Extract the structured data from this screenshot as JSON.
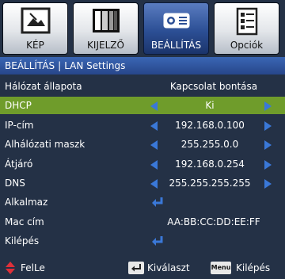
{
  "tabs": [
    {
      "label": "KÉP",
      "icon": "picture-icon",
      "active": false
    },
    {
      "label": "KIJELZŐ",
      "icon": "display-icon",
      "active": false
    },
    {
      "label": "BEÁLLÍTÁS",
      "icon": "projector-icon",
      "active": true
    },
    {
      "label": "Opciók",
      "icon": "options-icon",
      "active": false
    }
  ],
  "header": {
    "section": "BEÁLLÍTÁS",
    "separator": "|",
    "page": "LAN Settings"
  },
  "rows": {
    "status": {
      "label": "Hálózat állapota",
      "value": "Kapcsolat bontása"
    },
    "dhcp": {
      "label": "DHCP",
      "value": "Ki"
    },
    "ip": {
      "label": "IP-cím",
      "value": "192.168.0.100"
    },
    "subnet": {
      "label": "Alhálózati maszk",
      "value": "255.255.0.0"
    },
    "gateway": {
      "label": "Átjáró",
      "value": "192.168.0.254"
    },
    "dns": {
      "label": "DNS",
      "value": "255.255.255.255"
    },
    "apply": {
      "label": "Alkalmaz"
    },
    "mac": {
      "label": "Mac cím",
      "value": "AA:BB:CC:DD:EE:FF"
    },
    "exit": {
      "label": "Kilépés"
    }
  },
  "footer": {
    "nav_label": "FelLe",
    "select_label": "Kiválaszt",
    "menu_key": "Menu",
    "exit_label": "Kilépés"
  },
  "colors": {
    "background": "#243146",
    "selected_row": "#6f9c2b",
    "arrow": "#3a78d8",
    "header": "#2f579f"
  }
}
